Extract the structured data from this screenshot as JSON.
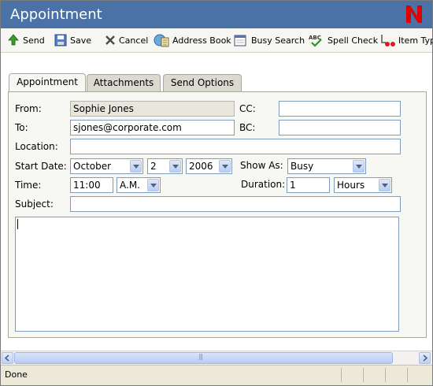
{
  "window": {
    "title": "Appointment",
    "logo_letter": "N"
  },
  "toolbar": {
    "items": [
      {
        "label": "Send",
        "icon": "send-icon"
      },
      {
        "label": "Save",
        "icon": "save-icon"
      },
      {
        "label": "Cancel",
        "icon": "cancel-icon"
      },
      {
        "label": "Address Book",
        "icon": "address-book-icon"
      },
      {
        "label": "Busy Search",
        "icon": "busy-search-icon"
      },
      {
        "label": "Spell Check",
        "icon": "spell-check-icon"
      },
      {
        "label": "Item Typ",
        "icon": "item-type-icon"
      }
    ]
  },
  "tabs": [
    {
      "label": "Appointment",
      "active": true
    },
    {
      "label": "Attachments",
      "active": false
    },
    {
      "label": "Send Options",
      "active": false
    }
  ],
  "form": {
    "from_label": "From:",
    "from_value": "Sophie Jones",
    "to_label": "To:",
    "to_value": "sjones@corporate.com",
    "cc_label": "CC:",
    "cc_value": "",
    "bc_label": "BC:",
    "bc_value": "",
    "location_label": "Location:",
    "location_value": "",
    "start_date_label": "Start Date:",
    "start_month": "October",
    "start_day": "2",
    "start_year": "2006",
    "show_as_label": "Show As:",
    "show_as_value": "Busy",
    "time_label": "Time:",
    "time_value": "11:00",
    "ampm_value": "A.M.",
    "duration_label": "Duration:",
    "duration_value": "1",
    "duration_unit": "Hours",
    "subject_label": "Subject:",
    "subject_value": "",
    "body_value": ""
  },
  "scrollbar": {
    "grip": "|||"
  },
  "status": {
    "text": "Done"
  },
  "colors": {
    "titlebar": "#4a72a7",
    "logo": "#e00000"
  }
}
